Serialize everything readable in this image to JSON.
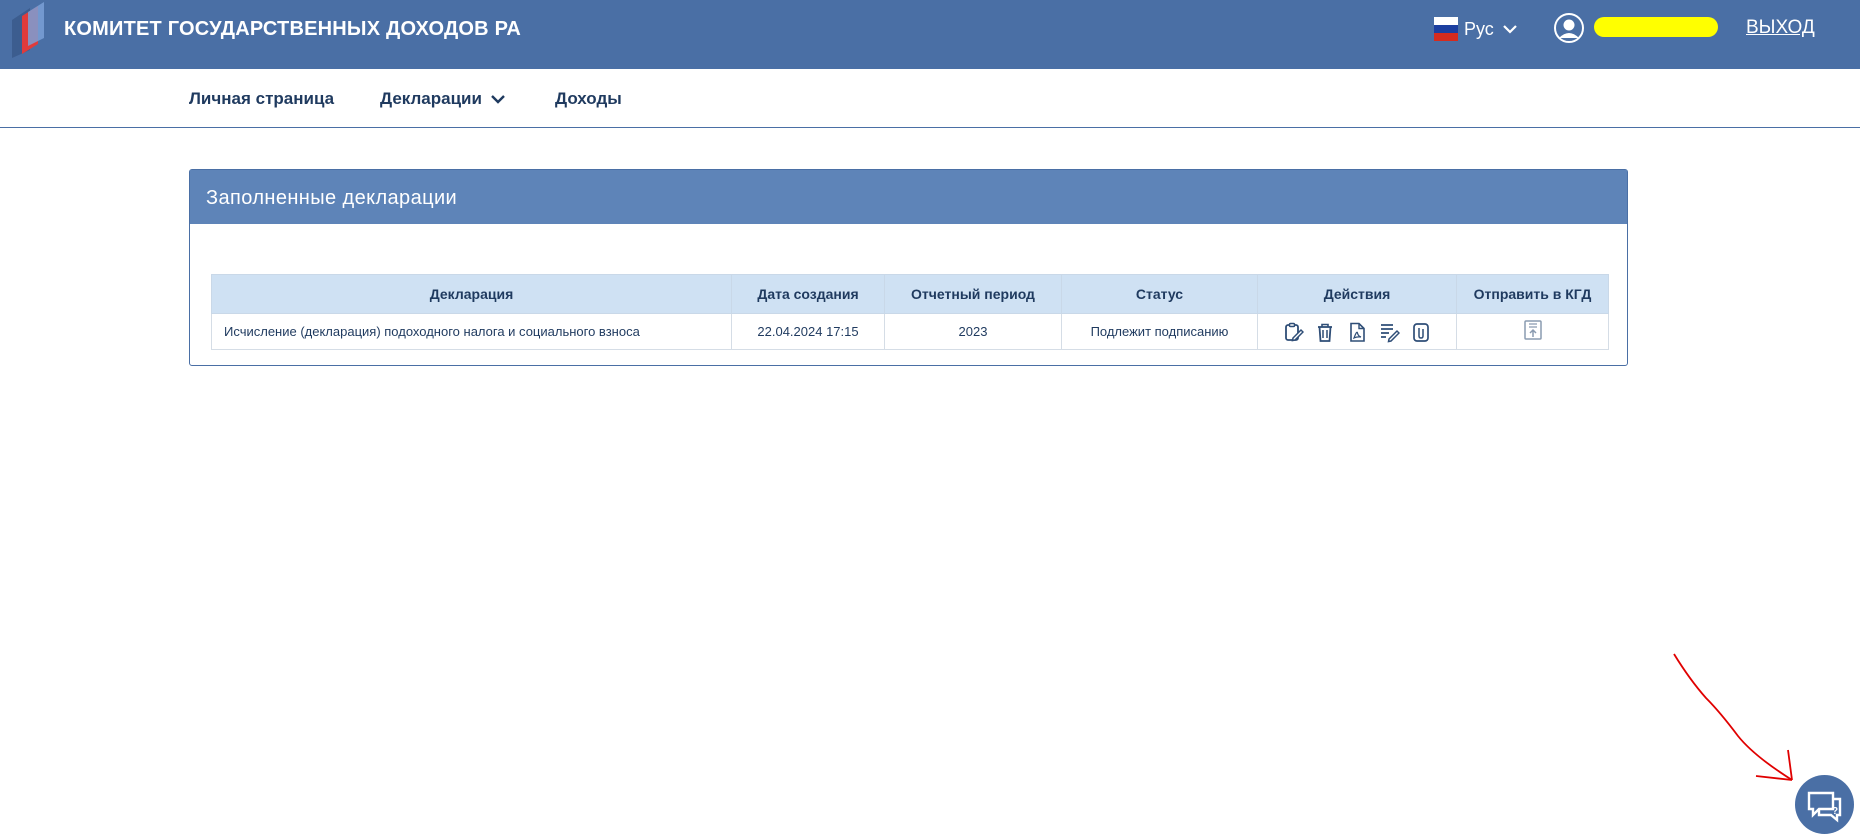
{
  "header": {
    "brand": "КОМИТЕТ ГОСУДАРСТВЕННЫХ ДОХОДОВ РА",
    "language": "Рус",
    "user_name": "",
    "logout": "ВЫХОД"
  },
  "nav": {
    "items": [
      {
        "label": "Личная страница"
      },
      {
        "label": "Декларации"
      },
      {
        "label": "Доходы"
      }
    ]
  },
  "panel": {
    "title": "Заполненные декларации",
    "columns": [
      "Декларация",
      "Дата создания",
      "Отчетный период",
      "Статус",
      "Действия",
      "Отправить в КГД"
    ],
    "rows": [
      {
        "declaration": "Исчисление (декларация) подоходного налога и социального взноса",
        "created": "22.04.2024 17:15",
        "period": "2023",
        "status": "Подлежит подписанию",
        "actions": [
          "edit-icon",
          "trash-icon",
          "pdf-icon",
          "sign-icon",
          "attach-icon"
        ],
        "send": "send-document-icon"
      }
    ]
  },
  "colors": {
    "header_bg": "#4a6fa5",
    "panel_head_bg": "#5e84b8",
    "table_head_bg": "#cfe1f3",
    "annotation_red": "#e00000",
    "redaction_yellow": "#ffff00"
  }
}
